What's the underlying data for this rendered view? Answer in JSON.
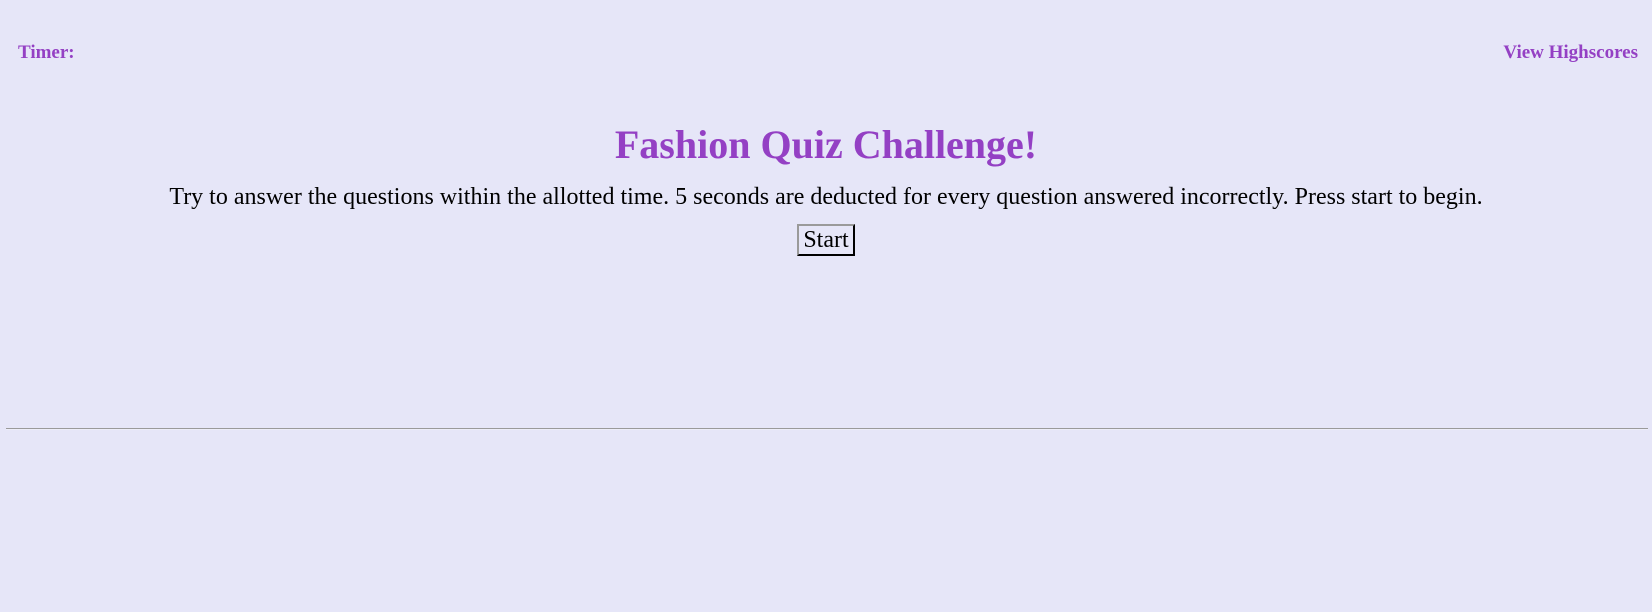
{
  "header": {
    "timer_label": "Timer:",
    "highscores_link": "View Highscores"
  },
  "quiz": {
    "title": "Fashion Quiz Challenge!",
    "instructions": "Try to answer the questions within the allotted time. 5 seconds are deducted for every question answered incorrectly. Press start to begin.",
    "start_button": "Start"
  },
  "colors": {
    "background": "#e6e6f8",
    "accent": "#9440c4",
    "text": "#000000"
  }
}
